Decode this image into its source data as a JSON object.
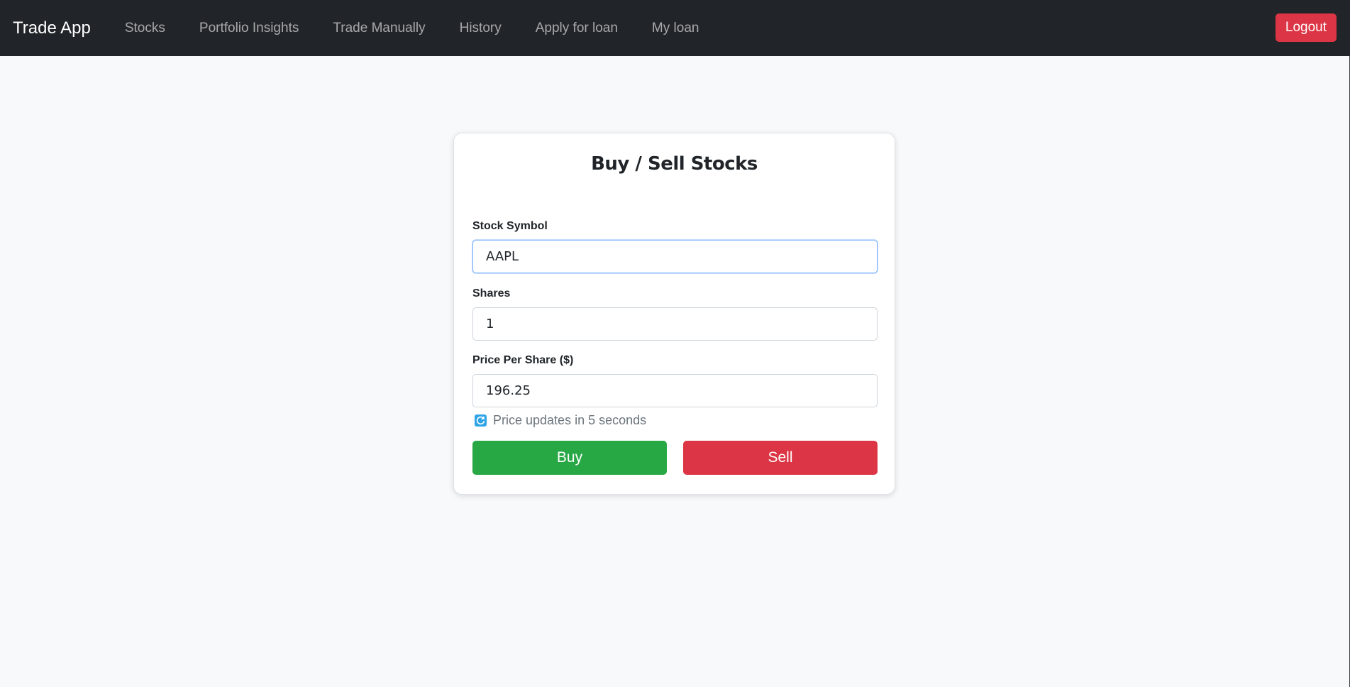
{
  "navbar": {
    "brand": "Trade App",
    "items": [
      {
        "label": "Stocks",
        "name": "nav-stocks"
      },
      {
        "label": "Portfolio Insights",
        "name": "nav-portfolio-insights"
      },
      {
        "label": "Trade Manually",
        "name": "nav-trade-manually"
      },
      {
        "label": "History",
        "name": "nav-history"
      },
      {
        "label": "Apply for loan",
        "name": "nav-apply-for-loan"
      },
      {
        "label": "My loan",
        "name": "nav-my-loan"
      }
    ],
    "logout_label": "Logout"
  },
  "form": {
    "title": "Buy / Sell Stocks",
    "symbol": {
      "label": "Stock Symbol",
      "value": "AAPL"
    },
    "shares": {
      "label": "Shares",
      "value": "1"
    },
    "price": {
      "label": "Price Per Share ($)",
      "value": "196.25"
    },
    "price_note": "Price updates in 5 seconds",
    "buy_label": "Buy",
    "sell_label": "Sell"
  },
  "icons": {
    "refresh": "refresh-icon"
  },
  "colors": {
    "navbar_bg": "#212529",
    "buy": "#28a745",
    "sell": "#dc3545",
    "logout": "#dc3545",
    "refresh_icon": "#2fa4e7"
  }
}
